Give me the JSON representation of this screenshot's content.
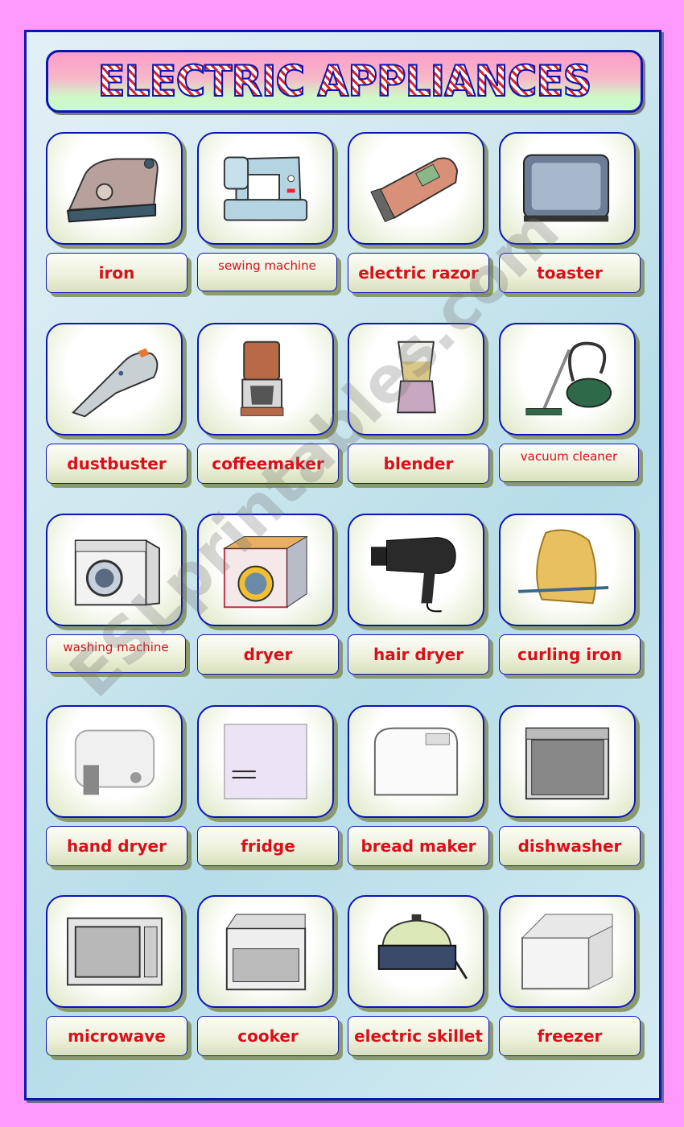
{
  "title": "ELECTRIC APPLIANCES",
  "watermark": "ESLprintables.com",
  "colors": {
    "page_background": "#ff99ff",
    "frame_border": "#0a16b4",
    "label_text": "#d8101c"
  },
  "items": [
    {
      "label": "iron",
      "icon": "iron-icon",
      "small": false
    },
    {
      "label": "sewing machine",
      "icon": "sewing-machine-icon",
      "small": true
    },
    {
      "label": "electric razor",
      "icon": "electric-razor-icon",
      "small": false
    },
    {
      "label": "toaster",
      "icon": "toaster-icon",
      "small": false
    },
    {
      "label": "dustbuster",
      "icon": "dustbuster-icon",
      "small": false
    },
    {
      "label": "coffeemaker",
      "icon": "coffeemaker-icon",
      "small": false
    },
    {
      "label": "blender",
      "icon": "blender-icon",
      "small": false
    },
    {
      "label": "vacuum cleaner",
      "icon": "vacuum-cleaner-icon",
      "small": true
    },
    {
      "label": "washing machine",
      "icon": "washing-machine-icon",
      "small": true
    },
    {
      "label": "dryer",
      "icon": "dryer-icon",
      "small": false
    },
    {
      "label": "hair dryer",
      "icon": "hair-dryer-icon",
      "small": false
    },
    {
      "label": "curling iron",
      "icon": "curling-iron-icon",
      "small": false
    },
    {
      "label": "hand dryer",
      "icon": "hand-dryer-icon",
      "small": false
    },
    {
      "label": "fridge",
      "icon": "fridge-icon",
      "small": false
    },
    {
      "label": "bread maker",
      "icon": "bread-maker-icon",
      "small": false
    },
    {
      "label": "dishwasher",
      "icon": "dishwasher-icon",
      "small": false
    },
    {
      "label": "microwave",
      "icon": "microwave-icon",
      "small": false
    },
    {
      "label": "cooker",
      "icon": "cooker-icon",
      "small": false
    },
    {
      "label": "electric skillet",
      "icon": "electric-skillet-icon",
      "small": false
    },
    {
      "label": "freezer",
      "icon": "freezer-icon",
      "small": false
    }
  ]
}
